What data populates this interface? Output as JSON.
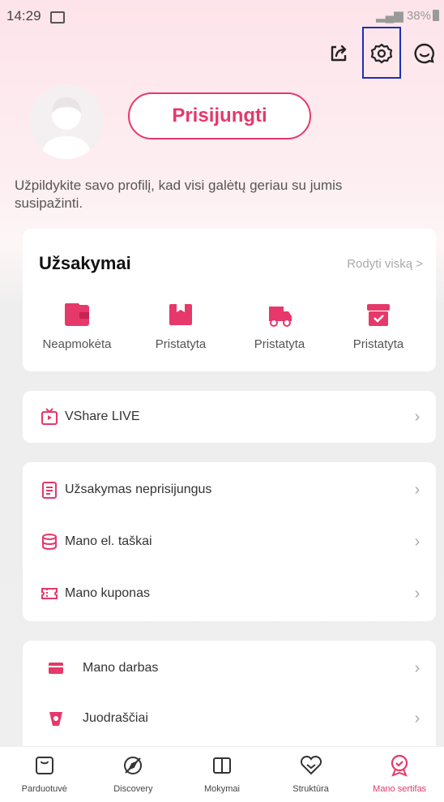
{
  "status_bar": {
    "time": "14:29",
    "battery": "38%"
  },
  "top_actions": {
    "share_icon": "share-icon",
    "settings_icon": "gear-icon",
    "chat_icon": "chat-bubble-icon"
  },
  "profile": {
    "login_label": "Prisijungti",
    "hint": "Užpildykite savo profilį, kad visi galėtų geriau su jumis susipažinti."
  },
  "orders": {
    "title": "Užsakymai",
    "view_all": "Rodyti viską >",
    "items": [
      {
        "label": "Neapmokėta",
        "icon": "wallet-icon"
      },
      {
        "label": "Pristatyta",
        "icon": "package-icon"
      },
      {
        "label": "Pristatyta",
        "icon": "truck-icon"
      },
      {
        "label": "Pristatyta",
        "icon": "box-check-icon"
      }
    ]
  },
  "live": {
    "label": "VShare LIVE",
    "icon": "live-tv-icon"
  },
  "menu": [
    {
      "label": "Užsakymas neprisijungus",
      "icon": "document-icon"
    },
    {
      "label": "Mano el. taškai",
      "icon": "coins-icon"
    },
    {
      "label": "Mano kuponas",
      "icon": "coupon-icon"
    }
  ],
  "menu2": [
    {
      "label": "Mano darbas",
      "icon": "wallet-icon"
    },
    {
      "label": "Juodraščiai",
      "icon": "cup-icon"
    }
  ],
  "bottom_nav": [
    {
      "label": "Parduotuvė",
      "icon": "shop-icon"
    },
    {
      "label": "Discovery",
      "icon": "compass-icon"
    },
    {
      "label": "Mokymai",
      "icon": "book-icon"
    },
    {
      "label": "Struktūra",
      "icon": "heart-badge-icon"
    },
    {
      "label": "Mano sertifas",
      "icon": "award-icon"
    }
  ],
  "colors": {
    "accent": "#e6386a",
    "highlight_box": "#1f2fb7"
  }
}
